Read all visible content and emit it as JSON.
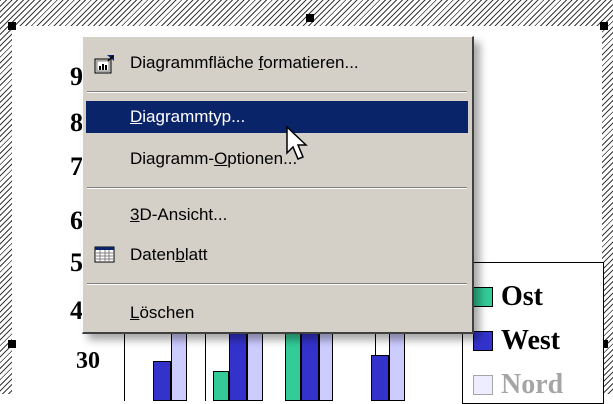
{
  "context_menu": {
    "items": [
      {
        "label_pre": "Diagrammfläche ",
        "label_u": "f",
        "label_post": "ormatieren...",
        "icon": "format-chart-area-icon"
      },
      {
        "label_pre": "",
        "label_u": "D",
        "label_post": "iagrammtyp...",
        "selected": true
      },
      {
        "label_pre": "Diagramm-",
        "label_u": "O",
        "label_post": "ptionen..."
      },
      {
        "label_pre": "",
        "label_u": "3",
        "label_post": "D-Ansicht..."
      },
      {
        "label_pre": "Daten",
        "label_u": "b",
        "label_post": "latt",
        "icon": "datasheet-icon"
      },
      {
        "label_pre": "",
        "label_u": "L",
        "label_post": "öschen"
      }
    ]
  },
  "chart": {
    "axis_fragments": [
      "9",
      "8",
      "7",
      "6",
      "5",
      "4"
    ],
    "axis_label": "30",
    "legend": [
      {
        "name": "Ost",
        "color": "#33cc99"
      },
      {
        "name": "West",
        "color": "#3333cc"
      },
      {
        "name": "Nord",
        "color": "#ccccff"
      }
    ]
  },
  "colors": {
    "menu_face": "#d4d0c8",
    "highlight": "#0a246a"
  }
}
